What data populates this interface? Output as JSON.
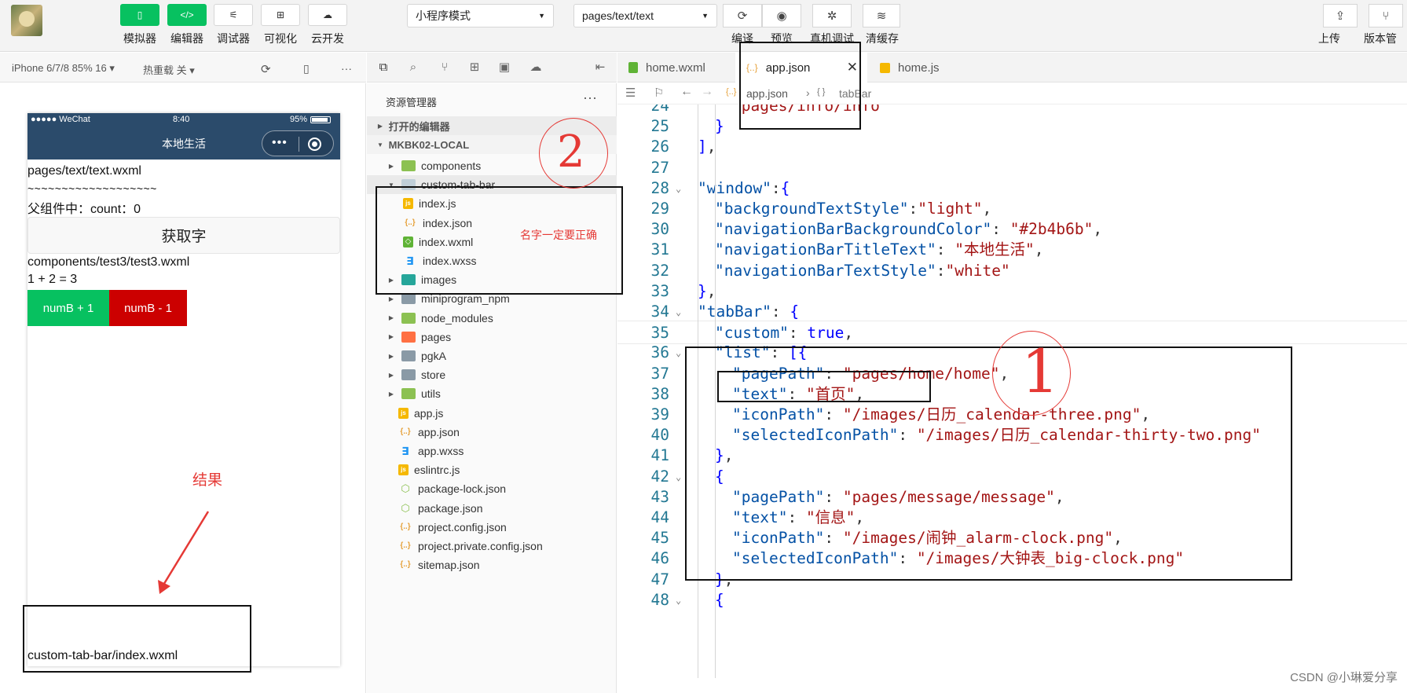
{
  "toolbar": {
    "buttons": [
      {
        "label": "模拟器",
        "icon": "phone-icon"
      },
      {
        "label": "编辑器",
        "icon": "code-icon"
      },
      {
        "label": "调试器",
        "icon": "sliders-icon"
      },
      {
        "label": "可视化",
        "icon": "layout-icon"
      },
      {
        "label": "云开发",
        "icon": "cloud-icon"
      }
    ],
    "mode_select": "小程序模式",
    "page_select": "pages/text/text",
    "actions": [
      {
        "label": "编译",
        "icon": "refresh-icon"
      },
      {
        "label": "预览",
        "icon": "eye-icon"
      },
      {
        "label": "真机调试",
        "icon": "bug-icon"
      },
      {
        "label": "清缓存",
        "icon": "layers-icon"
      }
    ],
    "right_actions": [
      {
        "label": "上传",
        "icon": "upload-icon"
      },
      {
        "label": "版本管",
        "icon": "branch-icon"
      }
    ]
  },
  "simulator": {
    "device": "iPhone 6/7/8 85% 16 ▾",
    "hot_reload": "热重载 关 ▾",
    "status": {
      "carrier": "●●●●● WeChat",
      "time": "8:40",
      "battery": "95%"
    },
    "nav_title": "本地生活",
    "nav_bg": "#2b4b6b",
    "lines": {
      "page_path": "pages/text/text.wxml",
      "tilde": "~~~~~~~~~~~~~~~~~~~",
      "parent_count": "父组件中：count：0",
      "get_button": "获取字",
      "comp_path": "components/test3/test3.wxml",
      "sum": "1 + 2 = 3",
      "plus_button": "numB + 1",
      "minus_button": "numB - 1",
      "tabbar_path": "custom-tab-bar/index.wxml"
    }
  },
  "explorer": {
    "title": "资源管理器",
    "sections": [
      "打开的编辑器",
      "MKBK02-LOCAL"
    ],
    "items": [
      {
        "name": "components",
        "kind": "folder",
        "color": "#8cc152",
        "indent": 1
      },
      {
        "name": "custom-tab-bar",
        "kind": "folder-open",
        "color": "#c0cfd9",
        "indent": 1
      },
      {
        "name": "index.js",
        "kind": "js",
        "indent": 2
      },
      {
        "name": "index.json",
        "kind": "json",
        "indent": 2
      },
      {
        "name": "index.wxml",
        "kind": "wxml",
        "indent": 2
      },
      {
        "name": "index.wxss",
        "kind": "wxss",
        "indent": 2
      },
      {
        "name": "images",
        "kind": "folder",
        "color": "#26a69a",
        "indent": 1
      },
      {
        "name": "miniprogram_npm",
        "kind": "folder",
        "color": "#8a9aa6",
        "indent": 1
      },
      {
        "name": "node_modules",
        "kind": "folder",
        "color": "#8cc152",
        "indent": 1
      },
      {
        "name": "pages",
        "kind": "folder",
        "color": "#ff7043",
        "indent": 1
      },
      {
        "name": "pgkA",
        "kind": "folder",
        "color": "#8a9aa6",
        "indent": 1
      },
      {
        "name": "store",
        "kind": "folder",
        "color": "#8a9aa6",
        "indent": 1
      },
      {
        "name": "utils",
        "kind": "folder",
        "color": "#8cc152",
        "indent": 1
      },
      {
        "name": "app.js",
        "kind": "js",
        "indent": 1
      },
      {
        "name": "app.json",
        "kind": "json",
        "indent": 1
      },
      {
        "name": "app.wxss",
        "kind": "wxss",
        "indent": 1
      },
      {
        "name": "eslintrc.js",
        "kind": "js",
        "indent": 1
      },
      {
        "name": "package-lock.json",
        "kind": "pkg",
        "indent": 1
      },
      {
        "name": "package.json",
        "kind": "pkg",
        "indent": 1
      },
      {
        "name": "project.config.json",
        "kind": "json",
        "indent": 1
      },
      {
        "name": "project.private.config.json",
        "kind": "json",
        "indent": 1
      },
      {
        "name": "sitemap.json",
        "kind": "json",
        "indent": 1
      }
    ]
  },
  "editor": {
    "tabs": [
      {
        "name": "home.wxml",
        "icon": "wxml-file-icon",
        "active": false
      },
      {
        "name": "app.json",
        "icon": "json-file-icon",
        "active": true
      },
      {
        "name": "home.js",
        "icon": "js-file-icon",
        "active": false
      }
    ],
    "breadcrumb": [
      "app.json",
      "tabBar"
    ],
    "lines": [
      {
        "n": "24",
        "fold": "",
        "indent": 2,
        "parts": [
          [
            "s",
            "\"pages/info/info\""
          ]
        ]
      },
      {
        "n": "25",
        "fold": "",
        "indent": 1,
        "parts": [
          [
            "b",
            "}"
          ]
        ]
      },
      {
        "n": "26",
        "fold": "",
        "indent": 0,
        "parts": [
          [
            "b",
            "]"
          ],
          [
            "p",
            ","
          ]
        ]
      },
      {
        "n": "27",
        "fold": "",
        "indent": 0,
        "parts": []
      },
      {
        "n": "28",
        "fold": "⌄",
        "indent": 0,
        "parts": [
          [
            "k",
            "\"window\""
          ],
          [
            "p",
            ":"
          ],
          [
            "b",
            "{"
          ]
        ]
      },
      {
        "n": "29",
        "fold": "",
        "indent": 1,
        "parts": [
          [
            "k",
            "\"backgroundTextStyle\""
          ],
          [
            "p",
            ":"
          ],
          [
            "s",
            "\"light\""
          ],
          [
            "p",
            ","
          ]
        ]
      },
      {
        "n": "30",
        "fold": "",
        "indent": 1,
        "parts": [
          [
            "k",
            "\"navigationBarBackgroundColor\""
          ],
          [
            "p",
            ": "
          ],
          [
            "s",
            "\"#2b4b6b\""
          ],
          [
            "p",
            ","
          ]
        ]
      },
      {
        "n": "31",
        "fold": "",
        "indent": 1,
        "parts": [
          [
            "k",
            "\"navigationBarTitleText\""
          ],
          [
            "p",
            ": "
          ],
          [
            "s",
            "\"本地生活\""
          ],
          [
            "p",
            ","
          ]
        ]
      },
      {
        "n": "32",
        "fold": "",
        "indent": 1,
        "parts": [
          [
            "k",
            "\"navigationBarTextStyle\""
          ],
          [
            "p",
            ":"
          ],
          [
            "s",
            "\"white\""
          ]
        ]
      },
      {
        "n": "33",
        "fold": "",
        "indent": 0,
        "parts": [
          [
            "b",
            "}"
          ],
          [
            "p",
            ","
          ]
        ]
      },
      {
        "n": "34",
        "fold": "⌄",
        "indent": 0,
        "parts": [
          [
            "k",
            "\"tabBar\""
          ],
          [
            "p",
            ": "
          ],
          [
            "b",
            "{"
          ]
        ]
      },
      {
        "n": "35",
        "fold": "",
        "indent": 1,
        "parts": [
          [
            "k",
            "\"custom\""
          ],
          [
            "p",
            ": "
          ],
          [
            "b",
            "true"
          ],
          [
            "p",
            ","
          ]
        ]
      },
      {
        "n": "36",
        "fold": "⌄",
        "indent": 1,
        "parts": [
          [
            "k",
            "\"list\""
          ],
          [
            "p",
            ": "
          ],
          [
            "b",
            "[{"
          ]
        ]
      },
      {
        "n": "37",
        "fold": "",
        "indent": 2,
        "parts": [
          [
            "k",
            "\"pagePath\""
          ],
          [
            "p",
            ": "
          ],
          [
            "s",
            "\"pages/home/home\""
          ],
          [
            "p",
            ","
          ]
        ]
      },
      {
        "n": "38",
        "fold": "",
        "indent": 2,
        "parts": [
          [
            "k",
            "\"text\""
          ],
          [
            "p",
            ": "
          ],
          [
            "s",
            "\"首页\""
          ],
          [
            "p",
            ","
          ]
        ]
      },
      {
        "n": "39",
        "fold": "",
        "indent": 2,
        "parts": [
          [
            "k",
            "\"iconPath\""
          ],
          [
            "p",
            ": "
          ],
          [
            "s",
            "\"/images/日历_calendar-three.png\""
          ],
          [
            "p",
            ","
          ]
        ]
      },
      {
        "n": "40",
        "fold": "",
        "indent": 2,
        "parts": [
          [
            "k",
            "\"selectedIconPath\""
          ],
          [
            "p",
            ": "
          ],
          [
            "s",
            "\"/images/日历_calendar-thirty-two.png\""
          ]
        ]
      },
      {
        "n": "41",
        "fold": "",
        "indent": 1,
        "parts": [
          [
            "b",
            "}"
          ],
          [
            "p",
            ","
          ]
        ]
      },
      {
        "n": "42",
        "fold": "⌄",
        "indent": 1,
        "parts": [
          [
            "b",
            "{"
          ]
        ]
      },
      {
        "n": "43",
        "fold": "",
        "indent": 2,
        "parts": [
          [
            "k",
            "\"pagePath\""
          ],
          [
            "p",
            ": "
          ],
          [
            "s",
            "\"pages/message/message\""
          ],
          [
            "p",
            ","
          ]
        ]
      },
      {
        "n": "44",
        "fold": "",
        "indent": 2,
        "parts": [
          [
            "k",
            "\"text\""
          ],
          [
            "p",
            ": "
          ],
          [
            "s",
            "\"信息\""
          ],
          [
            "p",
            ","
          ]
        ]
      },
      {
        "n": "45",
        "fold": "",
        "indent": 2,
        "parts": [
          [
            "k",
            "\"iconPath\""
          ],
          [
            "p",
            ": "
          ],
          [
            "s",
            "\"/images/闹钟_alarm-clock.png\""
          ],
          [
            "p",
            ","
          ]
        ]
      },
      {
        "n": "46",
        "fold": "",
        "indent": 2,
        "parts": [
          [
            "k",
            "\"selectedIconPath\""
          ],
          [
            "p",
            ": "
          ],
          [
            "s",
            "\"/images/大钟表_big-clock.png\""
          ]
        ]
      },
      {
        "n": "47",
        "fold": "",
        "indent": 1,
        "parts": [
          [
            "b",
            "}"
          ],
          [
            "p",
            ","
          ]
        ]
      },
      {
        "n": "48",
        "fold": "⌄",
        "indent": 1,
        "parts": [
          [
            "b",
            "{"
          ]
        ]
      }
    ]
  },
  "annotations": {
    "note_name": "名字一定要正确",
    "note_result": "结果",
    "circle_2": "2",
    "circle_1": "1"
  },
  "watermark": "CSDN @小琳爱分享"
}
